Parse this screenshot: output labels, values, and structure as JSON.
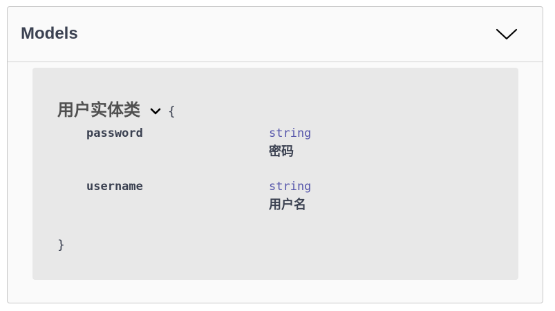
{
  "models": {
    "title": "Models",
    "toggle_icon": "chevron-down-icon"
  },
  "model": {
    "name": "用户实体类",
    "open_brace": "{",
    "close_brace": "}",
    "properties": [
      {
        "name": "password",
        "type": "string",
        "description": "密码"
      },
      {
        "name": "username",
        "type": "string",
        "description": "用户名"
      }
    ]
  },
  "colors": {
    "type_text": "#5555aa",
    "body_text": "#3b4151",
    "model_bg": "#e8e8e8"
  }
}
